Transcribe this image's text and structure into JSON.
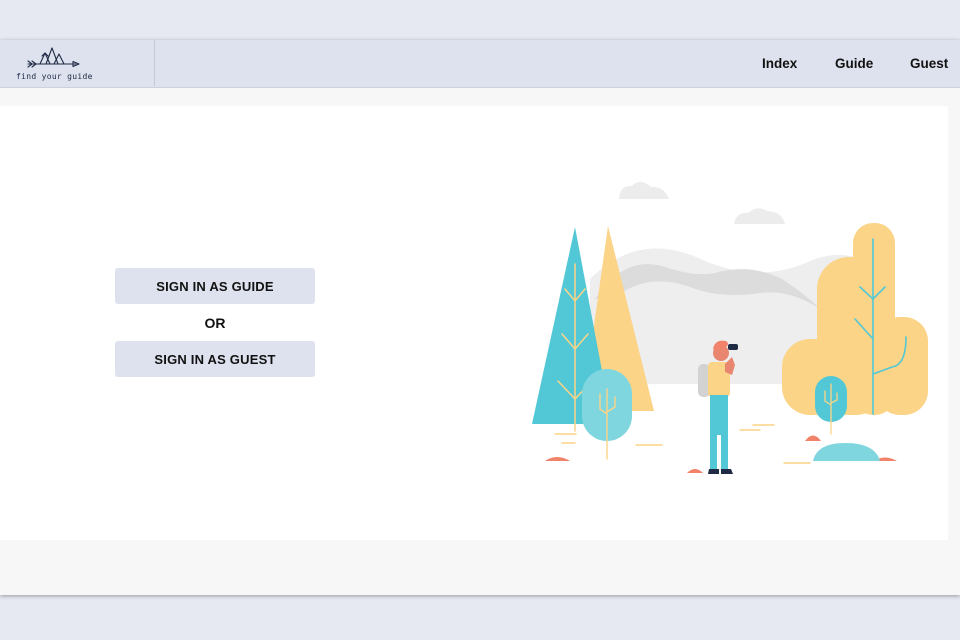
{
  "header": {
    "logo_text": "find your guide",
    "nav": [
      {
        "label": "Index"
      },
      {
        "label": "Guide"
      },
      {
        "label": "Guest"
      }
    ]
  },
  "main": {
    "sign_in_guide_label": "SIGN IN AS GUIDE",
    "or_label": "OR",
    "sign_in_guest_label": "SIGN IN AS GUEST"
  },
  "colors": {
    "page_background": "#e6e9f2",
    "navbar_background": "#dde2ee",
    "button_background": "#dde2ee",
    "illustration_teal": "#52c8d6",
    "illustration_yellow": "#fbd487",
    "illustration_coral": "#f2836b"
  },
  "icons": {
    "logo": "arrow-mountains-logo-icon"
  }
}
